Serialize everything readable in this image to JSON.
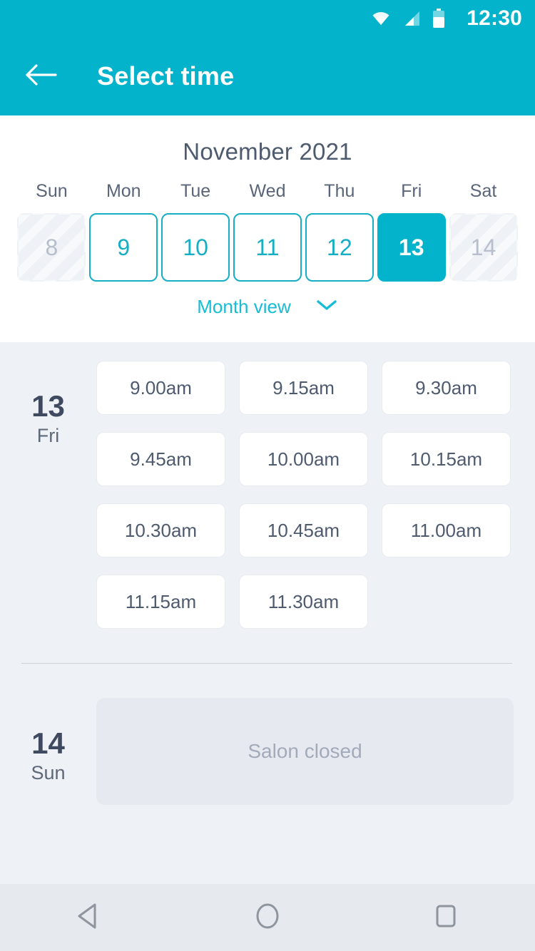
{
  "status_bar": {
    "time": "12:30",
    "icons": [
      "wifi-icon",
      "signal-icon",
      "battery-icon"
    ]
  },
  "app_bar": {
    "back_icon": "back-arrow-icon",
    "title": "Select time",
    "background_color": "#03b3cc"
  },
  "calendar": {
    "month_title": "November 2021",
    "weekdays": [
      "Sun",
      "Mon",
      "Tue",
      "Wed",
      "Thu",
      "Fri",
      "Sat"
    ],
    "days": [
      {
        "number": "8",
        "state": "disabled"
      },
      {
        "number": "9",
        "state": "available"
      },
      {
        "number": "10",
        "state": "available"
      },
      {
        "number": "11",
        "state": "available"
      },
      {
        "number": "12",
        "state": "available"
      },
      {
        "number": "13",
        "state": "selected"
      },
      {
        "number": "14",
        "state": "disabled"
      }
    ],
    "month_view_label": "Month view",
    "month_view_icon": "chevron-down-icon",
    "accent_color": "#03b3cc",
    "outline_color": "#16aec4"
  },
  "schedule": {
    "days": [
      {
        "date_number": "13",
        "day_of_week": "Fri",
        "slots": [
          "9.00am",
          "9.15am",
          "9.30am",
          "9.45am",
          "10.00am",
          "10.15am",
          "10.30am",
          "10.45am",
          "11.00am",
          "11.15am",
          "11.30am"
        ]
      },
      {
        "date_number": "14",
        "day_of_week": "Sun",
        "closed_message": "Salon closed"
      }
    ]
  },
  "nav_bar": {
    "buttons": [
      "back-triangle-icon",
      "home-circle-icon",
      "recents-square-icon"
    ]
  }
}
